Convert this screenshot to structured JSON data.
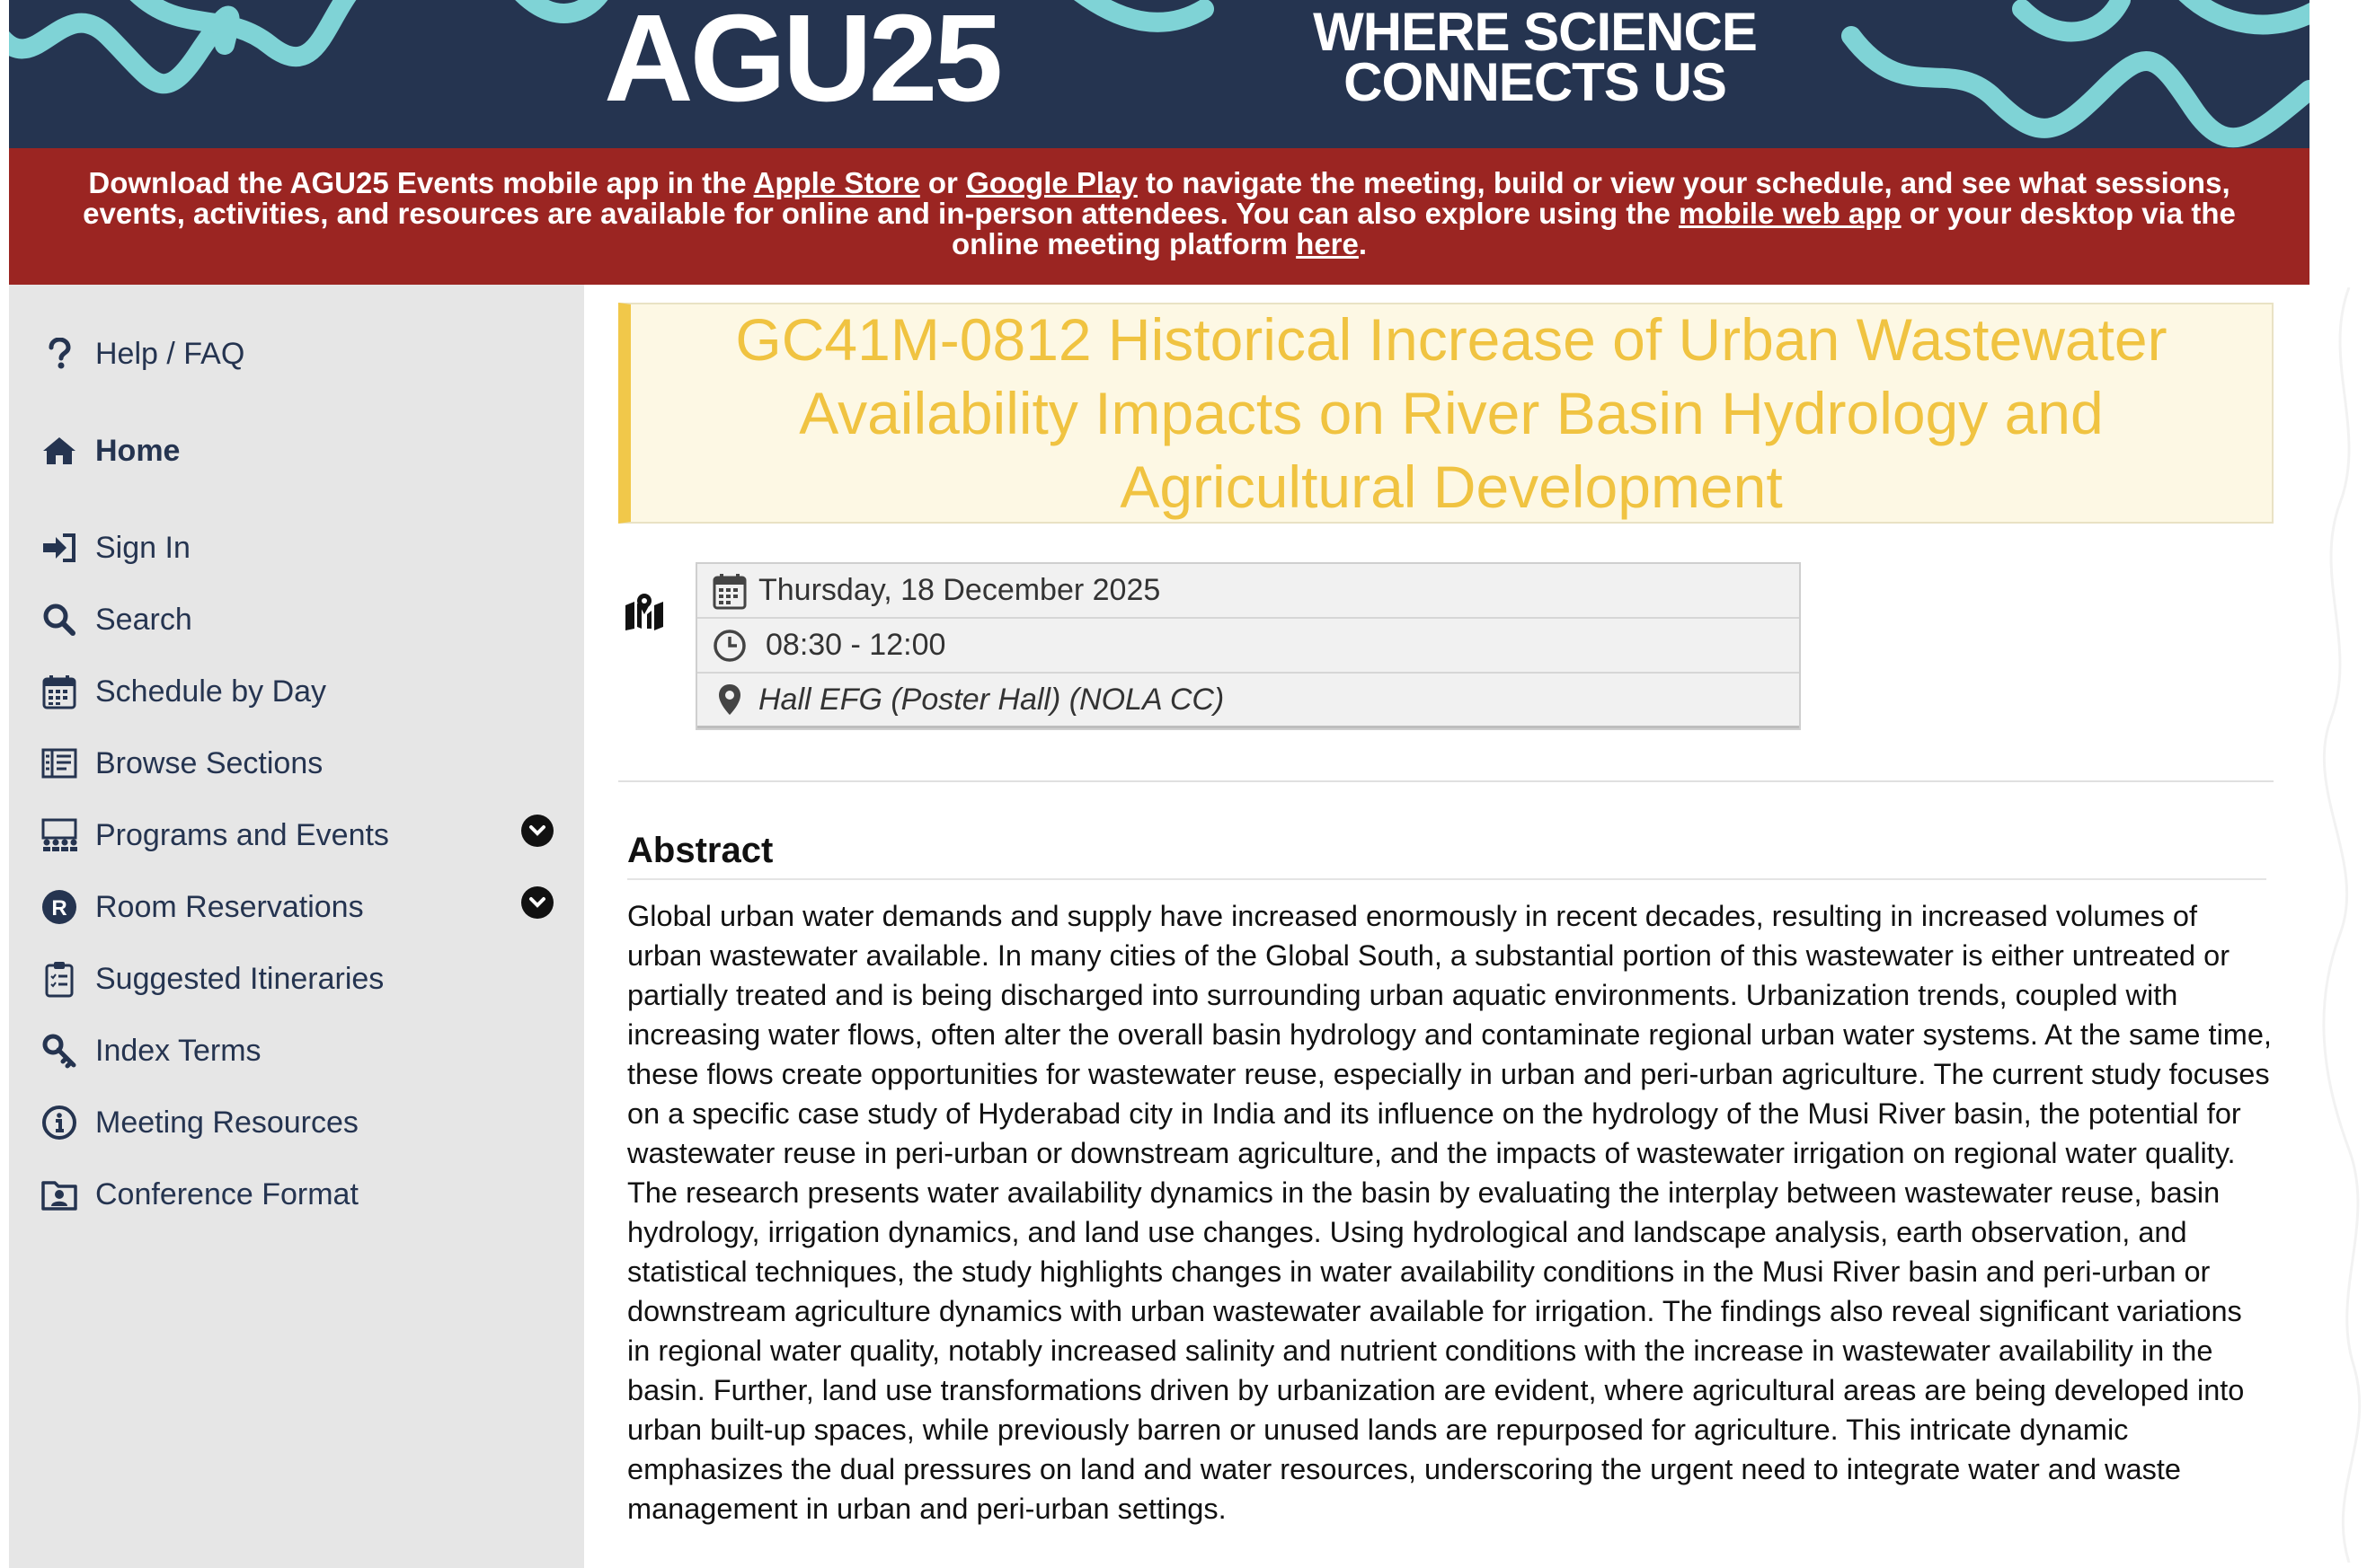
{
  "banner": {
    "logo": "AGU25",
    "tagline_line1": "WHERE SCIENCE",
    "tagline_line2": "CONNECTS US",
    "colors": {
      "bg": "#253450",
      "wave": "#7fd3d6"
    }
  },
  "notice": {
    "text_1": "Download the AGU25 Events mobile app in the ",
    "apple_link": "Apple Store",
    "text_2": " or ",
    "google_link": "Google Play",
    "text_3": " to navigate the meeting, build or view your schedule, and see what sessions, events, activities, and resources are available for online and in-person attendees. You can also explore using the ",
    "mobile_link": "mobile web app",
    "text_4": " or your desktop via the online meeting platform ",
    "here_link": "here",
    "text_5": ".",
    "color": "#9b2522"
  },
  "sidebar": {
    "items": [
      {
        "label": "Help / FAQ",
        "icon": "question-icon"
      },
      {
        "label": "Home",
        "icon": "home-icon"
      },
      {
        "label": "Sign In",
        "icon": "sign-in-icon"
      },
      {
        "label": "Search",
        "icon": "search-icon"
      },
      {
        "label": "Schedule by Day",
        "icon": "calendar-icon"
      },
      {
        "label": "Browse Sections",
        "icon": "sections-icon"
      },
      {
        "label": "Programs and Events",
        "icon": "programs-icon"
      },
      {
        "label": "Room Reservations",
        "icon": "room-icon"
      },
      {
        "label": "Suggested Itineraries",
        "icon": "clipboard-icon"
      },
      {
        "label": "Index Terms",
        "icon": "key-icon"
      },
      {
        "label": "Meeting Resources",
        "icon": "info-icon"
      },
      {
        "label": "Conference Format",
        "icon": "folder-user-icon"
      }
    ]
  },
  "session": {
    "title": "GC41M-0812 Historical Increase of Urban Wastewater Availability Impacts on River Basin Hydrology and Agricultural Development",
    "date": "Thursday, 18 December 2025",
    "time": "08:30 - 12:00",
    "location": "Hall EFG (Poster Hall) (NOLA CC)"
  },
  "abstract": {
    "heading": "Abstract",
    "body": "Global urban water demands and supply have increased enormously in recent decades, resulting in increased volumes of urban wastewater available. In many cities of the Global South, a substantial portion of this wastewater is either untreated or partially treated and is being discharged into surrounding urban aquatic environments. Urbanization trends, coupled with increasing water flows, often alter the overall basin hydrology and contaminate regional urban water systems. At the same time, these flows create opportunities for wastewater reuse, especially in urban and peri-urban agriculture. The current study focuses on a specific case study of Hyderabad city in India and its influence on the hydrology of the Musi River basin, the potential for wastewater reuse in peri-urban or downstream agriculture, and the impacts of wastewater irrigation on regional water quality. The research presents water availability dynamics in the basin by evaluating the interplay between wastewater reuse, basin hydrology, irrigation dynamics, and land use changes. Using hydrological and landscape analysis, earth observation, and statistical techniques, the study highlights changes in water availability conditions in the Musi River basin and peri-urban or downstream agriculture dynamics with urban wastewater available for irrigation. The findings also reveal significant variations in regional water quality, notably increased salinity and nutrient conditions with the increase in wastewater availability in the basin. Further, land use transformations driven by urbanization are evident, where agricultural areas are being developed into urban built-up spaces, while previously barren or unused lands are repurposed for agriculture. This intricate dynamic emphasizes the dual pressures on land and water resources, underscoring the urgent need to integrate water and waste management in urban and peri-urban settings."
  }
}
